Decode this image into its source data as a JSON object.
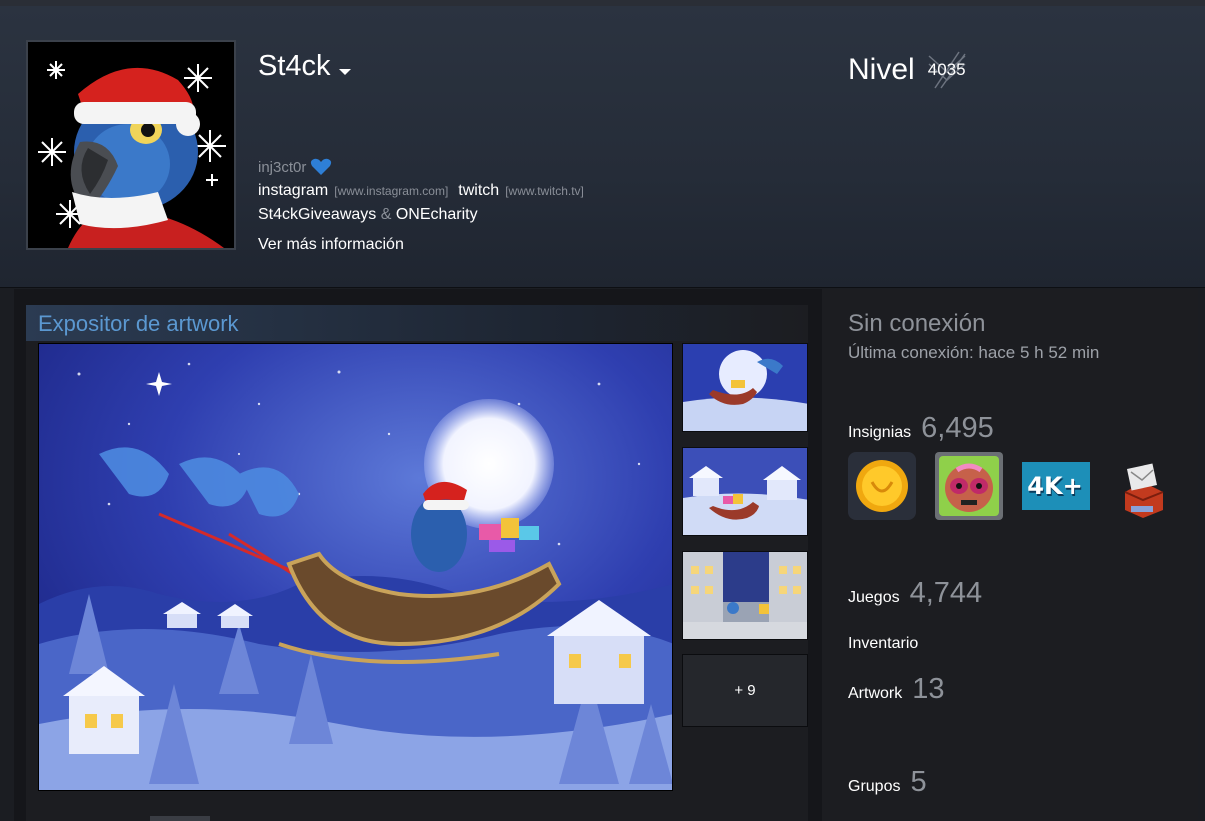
{
  "profile": {
    "name": "St4ck",
    "realname": "inj3ct0r",
    "links": [
      {
        "label": "instagram",
        "domain": "[www.instagram.com]"
      },
      {
        "label": "twitch",
        "domain": "[www.twitch.tv]"
      }
    ],
    "charity_left": "St4ckGiveaways",
    "charity_amp": " & ",
    "charity_right": "ONEcharity",
    "more_info": "Ver más información",
    "level_label": "Nivel",
    "level_value": "4035"
  },
  "showcase": {
    "title": "Expositor de artwork",
    "more_label": "+ 9"
  },
  "status": {
    "state": "Sin conexión",
    "last_seen": "Última conexión: hace 5 h 52 min"
  },
  "stats": {
    "badges_label": "Insignias",
    "badges_count": "6,495",
    "games_label": "Juegos",
    "games_count": "4,744",
    "inventory_label": "Inventario",
    "artwork_label": "Artwork",
    "artwork_count": "13",
    "groups_label": "Grupos",
    "groups_count": "5"
  },
  "badges": [
    {
      "icon": "gold-coin-icon"
    },
    {
      "icon": "monster-face-icon"
    },
    {
      "icon": "4k-plus-icon"
    },
    {
      "icon": "gift-box-icon"
    }
  ],
  "colors": {
    "accent": "#5b98d1",
    "background": "#1b1d22",
    "header": "#2b3340"
  }
}
